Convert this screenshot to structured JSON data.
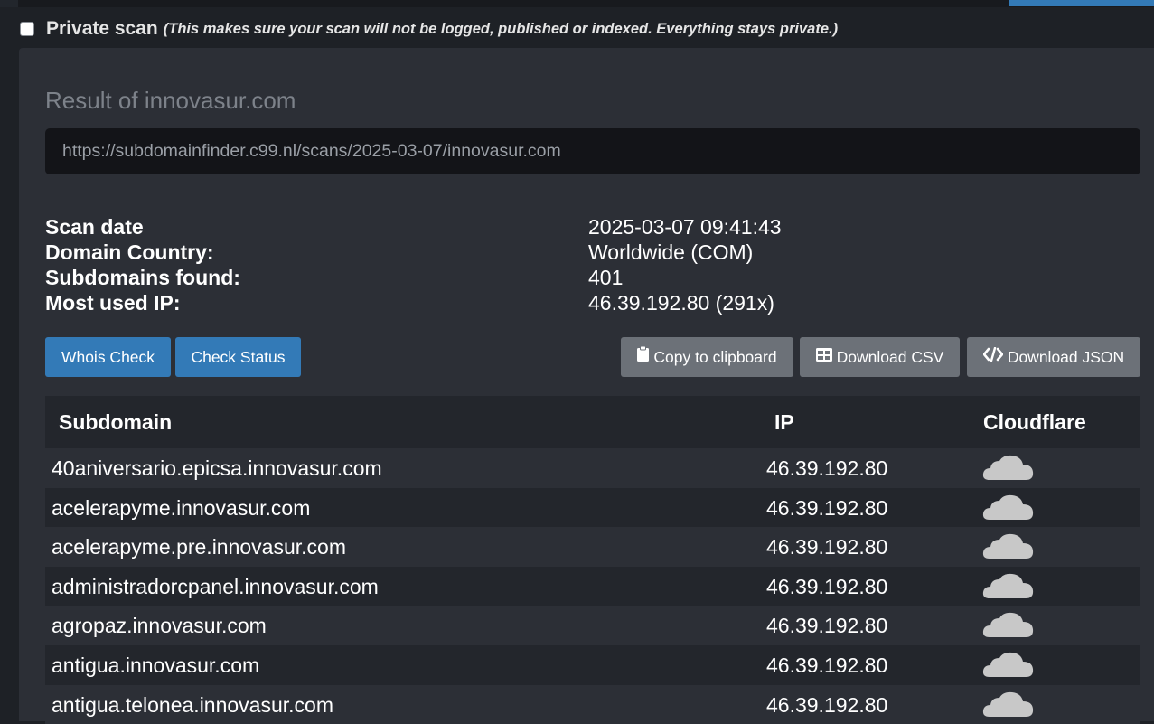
{
  "private_scan": {
    "label": "Private scan",
    "note": "(This makes sure your scan will not be logged, published or indexed. Everything stays private.)",
    "checked": false
  },
  "result": {
    "title": "Result of innovasur.com",
    "url": "https://subdomainfinder.c99.nl/scans/2025-03-07/innovasur.com"
  },
  "info": [
    {
      "label": "Scan date",
      "value": "2025-03-07 09:41:43"
    },
    {
      "label": "Domain Country:",
      "value": "Worldwide (COM)"
    },
    {
      "label": "Subdomains found:",
      "value": "401"
    },
    {
      "label": "Most used IP:",
      "value": "46.39.192.80 (291x)"
    }
  ],
  "buttons": {
    "whois": "Whois Check",
    "status": "Check Status",
    "copy": "Copy to clipboard",
    "csv": "Download CSV",
    "json": "Download JSON"
  },
  "table": {
    "headers": {
      "subdomain": "Subdomain",
      "ip": "IP",
      "cloudflare": "Cloudflare"
    },
    "rows": [
      {
        "subdomain": "40aniversario.epicsa.innovasur.com",
        "ip": "46.39.192.80",
        "cloudflare": "cloud-off-icon"
      },
      {
        "subdomain": "acelerapyme.innovasur.com",
        "ip": "46.39.192.80",
        "cloudflare": "cloud-off-icon"
      },
      {
        "subdomain": "acelerapyme.pre.innovasur.com",
        "ip": "46.39.192.80",
        "cloudflare": "cloud-off-icon"
      },
      {
        "subdomain": "administradorcpanel.innovasur.com",
        "ip": "46.39.192.80",
        "cloudflare": "cloud-off-icon"
      },
      {
        "subdomain": "agropaz.innovasur.com",
        "ip": "46.39.192.80",
        "cloudflare": "cloud-off-icon"
      },
      {
        "subdomain": "antigua.innovasur.com",
        "ip": "46.39.192.80",
        "cloudflare": "cloud-off-icon"
      },
      {
        "subdomain": "antigua.telonea.innovasur.com",
        "ip": "46.39.192.80",
        "cloudflare": "cloud-off-icon"
      }
    ]
  },
  "colors": {
    "accent_blue": "#337ab7",
    "button_gray": "#6c7178",
    "panel_bg": "#2c2f36",
    "cloud_gray": "#c8c8c8"
  }
}
